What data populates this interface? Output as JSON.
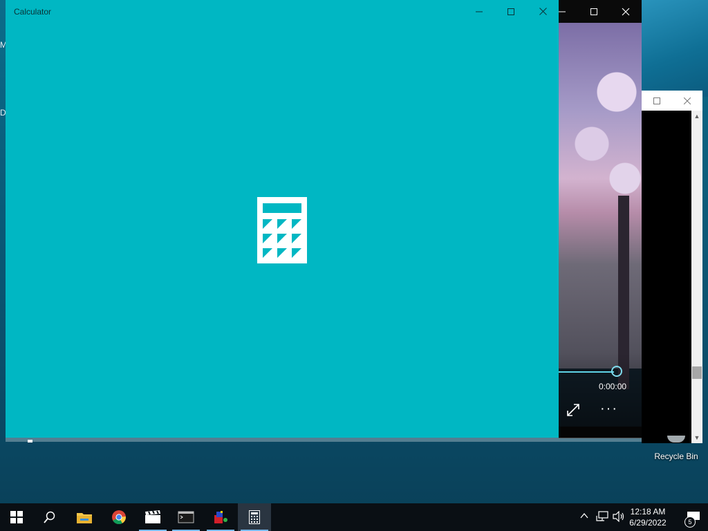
{
  "desktop": {
    "left_edge_text": [
      "M",
      "D"
    ],
    "recycle_bin_label": "Recycle Bin"
  },
  "calculator_window": {
    "title": "Calculator",
    "splash_icon": "calculator-icon",
    "background_color": "#00b7c3"
  },
  "media_window": {
    "time_elapsed": "0:00:00",
    "seek_position": 0.85,
    "accent_color": "#5fd3e6"
  },
  "taskbar": {
    "items": [
      {
        "name": "start",
        "icon": "windows-icon"
      },
      {
        "name": "search",
        "icon": "search-icon"
      },
      {
        "name": "file-explorer",
        "icon": "folder-icon"
      },
      {
        "name": "chrome",
        "icon": "chrome-icon"
      },
      {
        "name": "movies-tv",
        "icon": "clapperboard-icon"
      },
      {
        "name": "terminal",
        "icon": "terminal-icon"
      },
      {
        "name": "paint",
        "icon": "paint-icon"
      },
      {
        "name": "calculator",
        "icon": "calculator-icon"
      }
    ],
    "clock_time": "12:18 AM",
    "clock_date": "6/29/2022",
    "notification_count": "5"
  }
}
